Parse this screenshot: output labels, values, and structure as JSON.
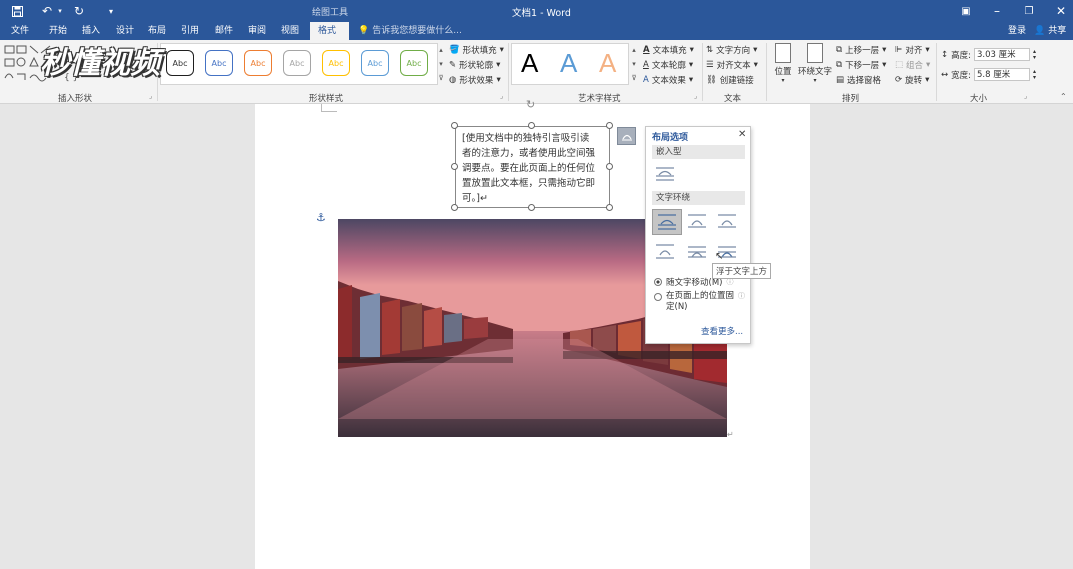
{
  "app": {
    "title": "文档1 - Word",
    "context_tab_group": "绘图工具",
    "watermark_text": "秒懂视频"
  },
  "titlebar": {
    "save_icon": "save-icon",
    "undo_icon": "undo-icon",
    "redo_icon": "redo-icon",
    "customize_icon": "customize-qat-icon",
    "right": {
      "login": "登录",
      "share": "共享"
    }
  },
  "menu": {
    "tabs": [
      "文件",
      "开始",
      "插入",
      "设计",
      "布局",
      "引用",
      "邮件",
      "审阅",
      "视图",
      "格式"
    ],
    "active_tab": "格式",
    "tell_me": "告诉我您想要做什么..."
  },
  "ribbon": {
    "insert_shapes": {
      "label": "插入形状"
    },
    "shape_styles": {
      "label": "形状样式",
      "abc_label": "Abc",
      "abc_colors": [
        "#4472c4",
        "#ed7d31",
        "#a5a5a5",
        "#ffc000",
        "#5b9bd5",
        "#70ad47"
      ],
      "fill": "形状填充",
      "outline": "形状轮廓",
      "effect": "形状效果"
    },
    "wordart": {
      "label": "艺术字样式",
      "letter": "A",
      "letter_colors": [
        "#000000",
        "#5b9bd5",
        "#f4b183"
      ],
      "text_fill": "文本填充",
      "text_outline": "文本轮廓",
      "text_effect": "文本效果"
    },
    "text": {
      "label": "文本",
      "direction": "文字方向",
      "align": "对齐文本",
      "link": "创建链接"
    },
    "arrange": {
      "label": "排列",
      "position": "位置",
      "wrap": "环绕文字",
      "bring_forward": "上移一层",
      "send_backward": "下移一层",
      "selection_pane": "选择窗格",
      "align": "对齐",
      "group": "组合",
      "rotate": "旋转"
    },
    "size": {
      "label": "大小",
      "height_label": "高度:",
      "height_value": "3.03 厘米",
      "width_label": "宽度:",
      "width_value": "5.8 厘米"
    }
  },
  "document": {
    "textbox_lines": [
      "[使用文档中的独特引言吸引读",
      "者的注意力，或者使用此空间强",
      "调要点。要在此页面上的任何位",
      "置放置此文本框，只需拖动它即",
      "可。]↵"
    ]
  },
  "layout_panel": {
    "title": "布局选项",
    "inline_section": "嵌入型",
    "wrap_section": "文字环绕",
    "move_with_text": "随文字移动(M)",
    "fix_position": "在页面上的位置固",
    "fix_position_2": "定(N)",
    "see_more": "查看更多...",
    "tooltip": "浮于文字上方"
  }
}
